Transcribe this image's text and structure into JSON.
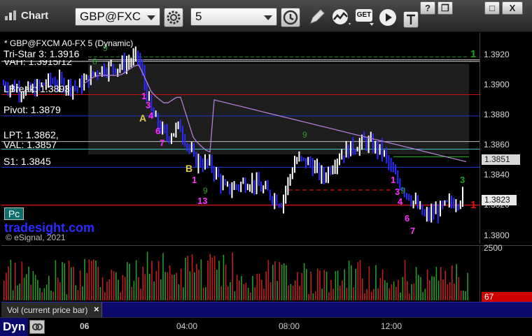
{
  "window": {
    "title": "Chart"
  },
  "toolbar": {
    "symbol": "GBP@FXC",
    "interval": "5",
    "get_label": "GET"
  },
  "window_controls": {
    "help": "?",
    "restore": "❐",
    "maximize": "□",
    "close": "X"
  },
  "chart": {
    "header": "* GBP@FXCM A0-FX 5 (Dynamic)",
    "levels": {
      "tristar": "Tri-Star 3: 1.3916",
      "vah": "VAH: 1.3915/12",
      "lbreak": "LBreak: 1.3893",
      "pivot": "Pivot: 1.3879",
      "lpt": "LPT: 1.3862,",
      "val": "VAL: 1.3857",
      "s1": "S1: 1.3845"
    },
    "badge": "Pc",
    "brand": "tradesight.com",
    "copyright": "© eSignal, 2021",
    "markers": {
      "a": "A",
      "b": "B"
    },
    "right_counts": {
      "top": "1",
      "mid": "1",
      "small": "3"
    }
  },
  "price_axis": {
    "ticks": [
      "1.3920",
      "1.3900",
      "1.3880",
      "1.3860",
      "1.3840",
      "1.3820",
      "1.3800"
    ],
    "tag_sma": "1.3851",
    "tag_last": "1.3823"
  },
  "volume": {
    "axis_top": "2500",
    "last_value": "67",
    "panel_label": "Vol (current price bar)"
  },
  "time_axis": {
    "labels": [
      "06",
      "04:00",
      "08:00",
      "12:00"
    ]
  },
  "bottom": {
    "label": "Dyn"
  },
  "colors": {
    "up": "#ffffff",
    "down": "#2b2bff",
    "sma": "#b07fd6",
    "support_red": "#d01010",
    "pivot_blue": "#1d38c8",
    "green_level": "#1a8a1a"
  }
}
